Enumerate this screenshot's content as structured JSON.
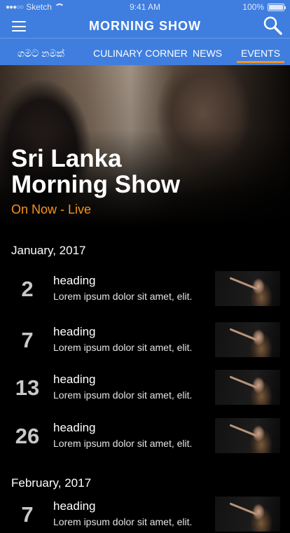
{
  "statusbar": {
    "carrier": "Sketch",
    "time": "9:41 AM",
    "battery": "100%",
    "battery_level": 1.0
  },
  "header": {
    "title": "MORNING SHOW"
  },
  "tabs": [
    {
      "label": "ගමට නමක්"
    },
    {
      "label": "CULINARY CORNER"
    },
    {
      "label": "NEWS"
    },
    {
      "label": "EVENTS",
      "active": true
    }
  ],
  "hero": {
    "title_line1": "Sri Lanka",
    "title_line2": "Morning Show",
    "subtitle": "On Now - Live"
  },
  "months": [
    {
      "label": "January, 2017",
      "events": [
        {
          "day": "2",
          "heading": "heading",
          "description": "Lorem ipsum dolor sit amet, elit."
        },
        {
          "day": "7",
          "heading": "heading",
          "description": "Lorem ipsum dolor sit amet, elit."
        },
        {
          "day": "13",
          "heading": "heading",
          "description": "Lorem ipsum dolor sit amet, elit."
        },
        {
          "day": "26",
          "heading": "heading",
          "description": "Lorem ipsum dolor sit amet, elit."
        }
      ]
    },
    {
      "label": "February, 2017",
      "events": [
        {
          "day": "7",
          "heading": "heading",
          "description": "Lorem ipsum dolor sit amet, elit."
        }
      ]
    }
  ],
  "colors": {
    "primary": "#3f7ede",
    "accent": "#f7931e",
    "background": "#000000"
  },
  "icons": {
    "menu": "hamburger-icon",
    "search": "search-icon",
    "wifi": "wifi-icon",
    "battery": "battery-icon"
  }
}
